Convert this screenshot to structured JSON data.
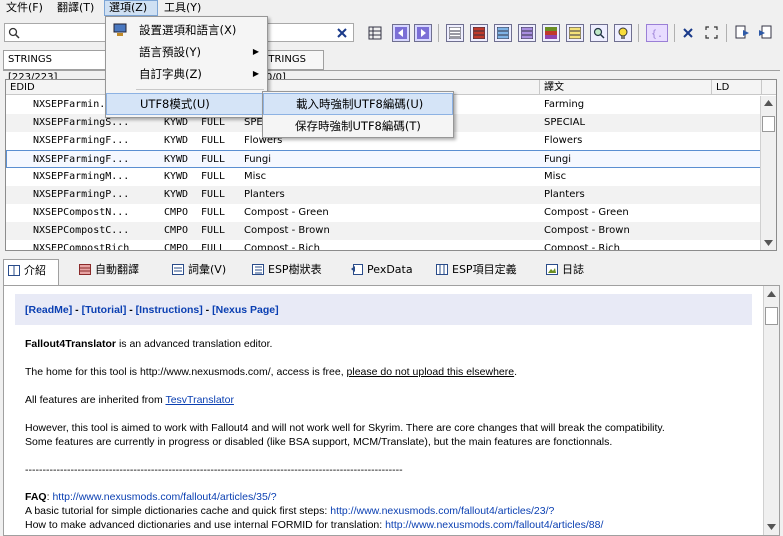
{
  "menubar": {
    "file": "文件(F)",
    "translate": "翻譯(T)",
    "options": "選項(Z)",
    "tools": "工具(Y)"
  },
  "options_menu": {
    "settings": "設置選項和語言(X)",
    "language_preset": "語言預設(Y)",
    "custom_dictionary": "自訂字典(Z)",
    "utf8_mode": "UTF8模式(U)"
  },
  "utf8_submenu": {
    "force_on_load": "載入時強制UTF8編碼(U)",
    "force_on_save": "保存時強制UTF8編碼(T)"
  },
  "toolbar": {
    "search_placeholder": "",
    "clear_icon": "close-icon",
    "accent_colors": [
      "#4a4ac8",
      "#c0392b",
      "#2e86c1",
      "#8e44ad",
      "#6b8e23",
      "#d4ac0d",
      "#27ae60",
      "#f1c40f"
    ]
  },
  "string_tabs": {
    "strings": "STRINGS [223/223]",
    "dlstrings": "STRINGS [0/0]"
  },
  "grid": {
    "headers": [
      "EDID",
      "",
      "譯文",
      "LD"
    ],
    "rows": [
      {
        "edid": "NXSEPFarmin...",
        "type": "",
        "field": "",
        "source": "",
        "target": "Farming"
      },
      {
        "edid": "NXSEPFarmingS...",
        "type": "KYWD",
        "field": "FULL",
        "source": "SPECIAL",
        "target": "SPECIAL"
      },
      {
        "edid": "NXSEPFarmingF...",
        "type": "KYWD",
        "field": "FULL",
        "source": "Flowers",
        "target": "Flowers"
      },
      {
        "edid": "NXSEPFarmingF...",
        "type": "KYWD",
        "field": "FULL",
        "source": "Fungi",
        "target": "Fungi"
      },
      {
        "edid": "NXSEPFarmingM...",
        "type": "KYWD",
        "field": "FULL",
        "source": "Misc",
        "target": "Misc"
      },
      {
        "edid": "NXSEPFarmingP...",
        "type": "KYWD",
        "field": "FULL",
        "source": "Planters",
        "target": "Planters"
      },
      {
        "edid": "NXSEPCompostN...",
        "type": "CMPO",
        "field": "FULL",
        "source": "Compost - Green",
        "target": "Compost - Green"
      },
      {
        "edid": "NXSEPCompostC...",
        "type": "CMPO",
        "field": "FULL",
        "source": "Compost - Brown",
        "target": "Compost - Brown"
      },
      {
        "edid": "NXSEPCompostRich",
        "type": "CMPO",
        "field": "FULL",
        "source": "Compost - Rich",
        "target": "Compost - Rich"
      }
    ]
  },
  "bottom_tabs": [
    "介紹",
    "自動翻譯",
    "詞彙(V)",
    "ESP樹狀表",
    "PexData",
    "ESP項目定義",
    "日誌"
  ],
  "doc": {
    "nav": {
      "readme": "[ReadMe]",
      "sep1": " - ",
      "tutorial": "[Tutorial]",
      "sep2": " - ",
      "instructions": "[Instructions]",
      "sep3": " - ",
      "nexus": "[Nexus Page]"
    },
    "app_name": "Fallout4Translator",
    "intro": " is an advanced translation editor.",
    "home_prefix": "The home for this tool is http://www.nexusmods.com/, access is free, ",
    "home_link": "please do not upload this elsewhere",
    "home_suffix": ".",
    "inherit_prefix": "All features are inherited from ",
    "inherit_link": "TesvTranslator",
    "compat1": "However, this tool is aimed to work with Fallout4 and will not work well for Skyrim. There are core changes that will break the compatibility.",
    "compat2": "Some features are currently in progress or disabled (like BSA support, MCM/Translate), but the main features are fonctionnals.",
    "divider": "------------------------------------------------------------------------------------------------------------",
    "faq_label": "FAQ",
    "faq_sep": ": ",
    "faq_link": "http://www.nexusmods.com/fallout4/articles/35/?",
    "tut_prefix": "A basic tutorial for simple dictionaries cache and quick first steps: ",
    "tut_link": "http://www.nexusmods.com/fallout4/articles/23/?",
    "adv_prefix": "How to make advanced dictionaries and use internal FORMID for translation: ",
    "adv_link": "http://www.nexusmods.com/fallout4/articles/88/"
  }
}
